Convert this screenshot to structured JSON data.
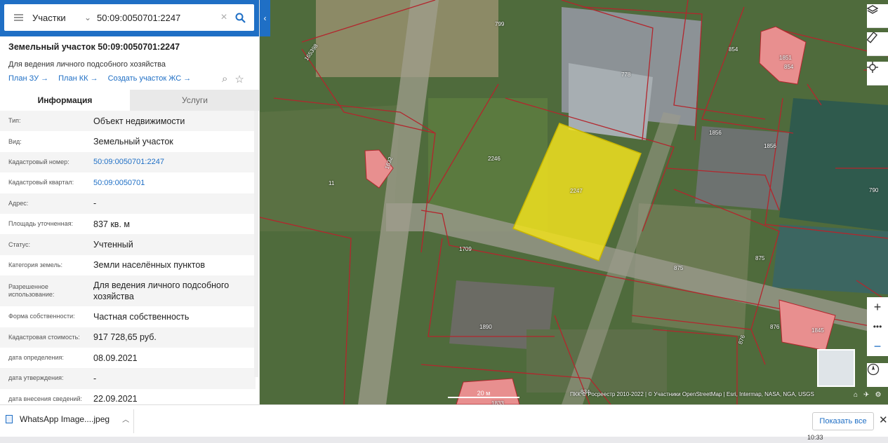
{
  "search": {
    "type_label": "Участки",
    "query": "50:09:0050701:2247"
  },
  "parcel": {
    "title": "Земельный участок 50:09:0050701:2247",
    "subtitle": "Для ведения личного подсобного хозяйства",
    "links": [
      "План ЗУ →",
      "План КК →",
      "Создать участок ЖС →"
    ]
  },
  "tabs": {
    "info": "Информация",
    "services": "Услуги"
  },
  "info_rows": [
    {
      "label": "Тип:",
      "value": "Объект недвижимости"
    },
    {
      "label": "Вид:",
      "value": "Земельный участок"
    },
    {
      "label": "Кадастровый номер:",
      "value": "50:09:0050701:2247",
      "link": true
    },
    {
      "label": "Кадастровый квартал:",
      "value": "50:09:0050701",
      "link": true
    },
    {
      "label": "Адрес:",
      "value": "-"
    },
    {
      "label": "Площадь уточненная:",
      "value": "837 кв. м"
    },
    {
      "label": "Статус:",
      "value": "Учтенный"
    },
    {
      "label": "Категория земель:",
      "value": "Земли населённых пунктов"
    },
    {
      "label": "Разрешенное использование:",
      "value": "Для ведения личного подсобного хозяйства"
    },
    {
      "label": "Форма собственности:",
      "value": "Частная собственность"
    },
    {
      "label": "Кадастровая стоимость:",
      "value": "917 728,65 руб."
    },
    {
      "label": "дата определения:",
      "value": "08.09.2021"
    },
    {
      "label": "дата утверждения:",
      "value": "-"
    },
    {
      "label": "дата внесения сведений:",
      "value": "22.09.2021"
    }
  ],
  "map": {
    "parcel_labels": [
      "799",
      "778",
      "854",
      "1851",
      "854",
      "1856",
      "1856",
      "2246",
      "2247",
      "1632",
      "11",
      "165398",
      "790",
      "1709",
      "875",
      "875",
      "876",
      "1845",
      "1890",
      "876",
      "834",
      "1833"
    ],
    "scale_label": "20 м",
    "attribution": "ПКК © Росреестр 2010-2022 | © Участники OpenStreetMap | Esri, Intermap, NASA, NGA, USGS",
    "selected_color": "#f0e11e",
    "boundary_color": "#b3262d"
  },
  "download_bar": {
    "file_name": "WhatsApp Image....jpeg",
    "show_all": "Показать все"
  },
  "taskbar": {
    "clock": "10:33"
  }
}
